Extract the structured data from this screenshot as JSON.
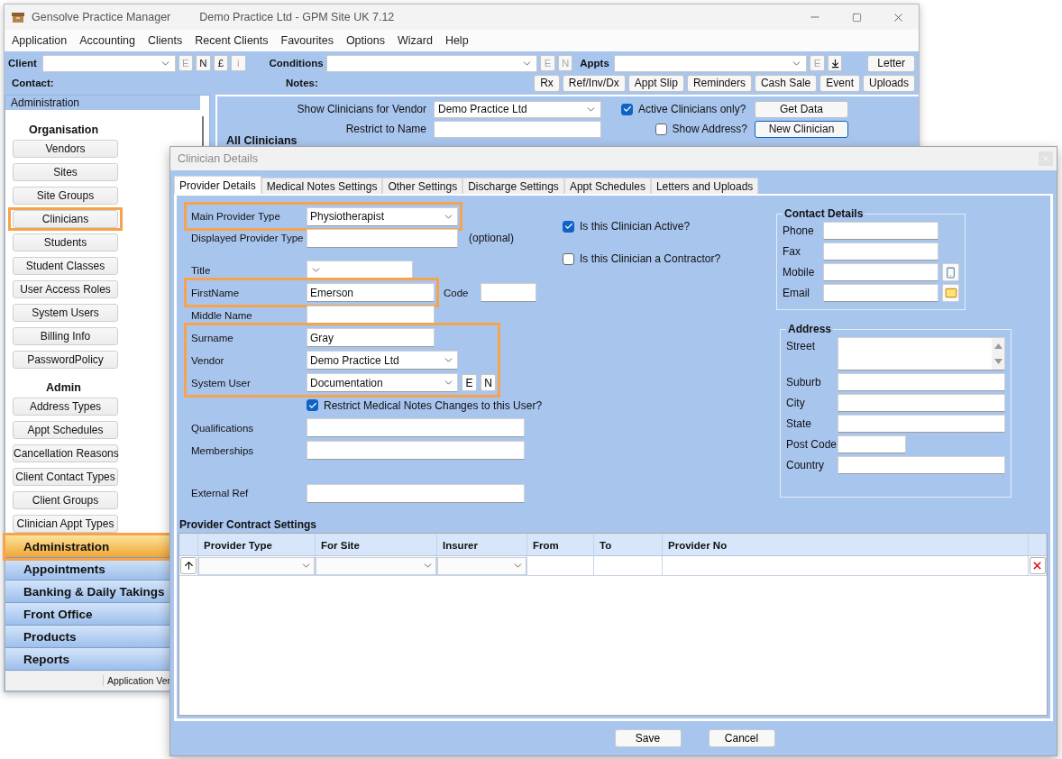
{
  "main_window": {
    "title": "Gensolve Practice Manager",
    "subtitle": "Demo Practice Ltd - GPM Site UK 7.12"
  },
  "menu": [
    "Application",
    "Accounting",
    "Clients",
    "Recent Clients",
    "Favourites",
    "Options",
    "Wizard",
    "Help"
  ],
  "toolbar": {
    "client_label": "Client",
    "client_buttons": [
      {
        "label": "E",
        "disabled": true
      },
      {
        "label": "N",
        "disabled": false
      },
      {
        "label": "£",
        "disabled": false
      },
      {
        "label": "i",
        "disabled": true
      }
    ],
    "conditions_label": "Conditions",
    "conditions_buttons": [
      {
        "label": "E",
        "disabled": true
      },
      {
        "label": "N",
        "disabled": true
      }
    ],
    "appts_label": "Appts",
    "appts_buttons": [
      {
        "label": "E",
        "disabled": true
      }
    ],
    "letter_button": "Letter",
    "contact_label": "Contact:",
    "notes_label": "Notes:",
    "action_buttons": [
      "Rx",
      "Ref/Inv/Dx",
      "Appt Slip",
      "Reminders",
      "Cash Sale",
      "Event",
      "Uploads"
    ]
  },
  "sidebar": {
    "header": "Administration",
    "sections": [
      {
        "title": "Organisation",
        "items": [
          {
            "label": "Vendors",
            "highlighted": false
          },
          {
            "label": "Sites",
            "highlighted": false
          },
          {
            "label": "Site Groups",
            "highlighted": false
          },
          {
            "label": "Clinicians",
            "highlighted": true
          },
          {
            "label": "Students",
            "highlighted": false
          },
          {
            "label": "Student Classes",
            "highlighted": false
          },
          {
            "label": "User Access Roles",
            "highlighted": false
          },
          {
            "label": "System Users",
            "highlighted": false
          },
          {
            "label": "Billing Info",
            "highlighted": false
          },
          {
            "label": "PasswordPolicy",
            "highlighted": false
          }
        ]
      },
      {
        "title": "Admin",
        "items": [
          {
            "label": "Address Types",
            "highlighted": false
          },
          {
            "label": "Appt Schedules",
            "highlighted": false
          },
          {
            "label": "Cancellation Reasons",
            "highlighted": false
          },
          {
            "label": "Client Contact Types",
            "highlighted": false
          },
          {
            "label": "Client Groups",
            "highlighted": false
          },
          {
            "label": "Clinician Appt Types",
            "highlighted": false
          }
        ]
      }
    ],
    "nav": [
      {
        "label": "Administration",
        "selected": true,
        "highlighted": true
      },
      {
        "label": "Appointments",
        "selected": false,
        "highlighted": false
      },
      {
        "label": "Banking & Daily Takings",
        "selected": false,
        "highlighted": false
      },
      {
        "label": "Front Office",
        "selected": false,
        "highlighted": false
      },
      {
        "label": "Products",
        "selected": false,
        "highlighted": false
      },
      {
        "label": "Reports",
        "selected": false,
        "highlighted": false
      }
    ],
    "status": "Application Ver"
  },
  "clinicians_panel": {
    "vendor_label": "Show Clinicians for Vendor",
    "vendor_value": "Demo Practice Ltd",
    "active_only": {
      "label": "Active Clinicians only?",
      "checked": true
    },
    "restrict_label": "Restrict to Name",
    "show_address": {
      "label": "Show Address?",
      "checked": false
    },
    "buttons": [
      "Get Data",
      "New Clinician"
    ],
    "list_title": "All Clinicians"
  },
  "dialog": {
    "title": "Clinician Details",
    "tabs": [
      {
        "label": "Provider Details",
        "selected": true
      },
      {
        "label": "Medical Notes Settings",
        "selected": false
      },
      {
        "label": "Other Settings",
        "selected": false
      },
      {
        "label": "Discharge Settings",
        "selected": false
      },
      {
        "label": "Appt Schedules",
        "selected": false
      },
      {
        "label": "Letters and Uploads",
        "selected": false
      }
    ],
    "form_blocks": [
      [
        {
          "highlighted": true,
          "rows": [
            {
              "kind": "select",
              "label": "Main Provider Type",
              "value": "Physiotherapist"
            }
          ]
        },
        {
          "highlighted": false,
          "rows": [
            {
              "kind": "text",
              "label": "Displayed Provider Type",
              "note": "(optional)"
            }
          ]
        }
      ],
      [
        {
          "highlighted": false,
          "rows": [
            {
              "kind": "select",
              "label": "Title"
            }
          ]
        },
        {
          "highlighted": true,
          "rows": [
            {
              "kind": "text",
              "label": "FirstName",
              "value": "Emerson"
            }
          ],
          "side_field": {
            "label": "Code"
          }
        },
        {
          "highlighted": false,
          "rows": [
            {
              "kind": "text",
              "label": "Middle Name"
            }
          ]
        },
        {
          "highlighted": true,
          "rows": [
            {
              "kind": "text",
              "label": "Surname",
              "value": "Gray"
            },
            {
              "kind": "select",
              "label": "Vendor",
              "value": "Demo Practice Ltd"
            },
            {
              "kind": "select",
              "label": "System User",
              "value": "Documentation",
              "buttons": [
                "E",
                "N"
              ]
            }
          ]
        },
        {
          "highlighted": false,
          "rows": [
            {
              "kind": "checkbox",
              "label": "Restrict Medical Notes Changes to this User?",
              "checked": true
            }
          ]
        },
        {
          "highlighted": false,
          "rows": [
            {
              "kind": "text",
              "label": "Qualifications"
            },
            {
              "kind": "text",
              "label": "Memberships"
            }
          ]
        }
      ],
      [
        {
          "highlighted": false,
          "rows": [
            {
              "kind": "text",
              "label": "External Ref"
            }
          ]
        }
      ]
    ],
    "status_checks": [
      {
        "label": "Is this Clinician Active?",
        "checked": true
      },
      {
        "label": "Is this Clinician a Contractor?",
        "checked": false
      }
    ],
    "contact_details": {
      "title": "Contact Details",
      "fields": [
        {
          "label": "Phone",
          "kind": "text"
        },
        {
          "label": "Fax",
          "kind": "text"
        },
        {
          "label": "Mobile",
          "kind": "phone"
        },
        {
          "label": "Email",
          "kind": "email"
        }
      ]
    },
    "address": {
      "title": "Address",
      "fields": [
        {
          "label": "Street",
          "kind": "multiline"
        },
        {
          "label": "Suburb",
          "kind": "text"
        },
        {
          "label": "City",
          "kind": "text"
        },
        {
          "label": "State",
          "kind": "text"
        },
        {
          "label": "Post Code",
          "kind": "short"
        },
        {
          "label": "Country",
          "kind": "text"
        }
      ]
    },
    "contract_settings": {
      "title": "Provider Contract Settings",
      "columns": [
        "Provider Type",
        "For Site",
        "Insurer",
        "From",
        "To",
        "Provider No"
      ],
      "new_row": [
        {
          "kind": "select"
        },
        {
          "kind": "select"
        },
        {
          "kind": "select"
        },
        {
          "kind": "text"
        },
        {
          "kind": "text"
        },
        {
          "kind": "text"
        }
      ]
    },
    "buttons": [
      "Save",
      "Cancel"
    ]
  }
}
